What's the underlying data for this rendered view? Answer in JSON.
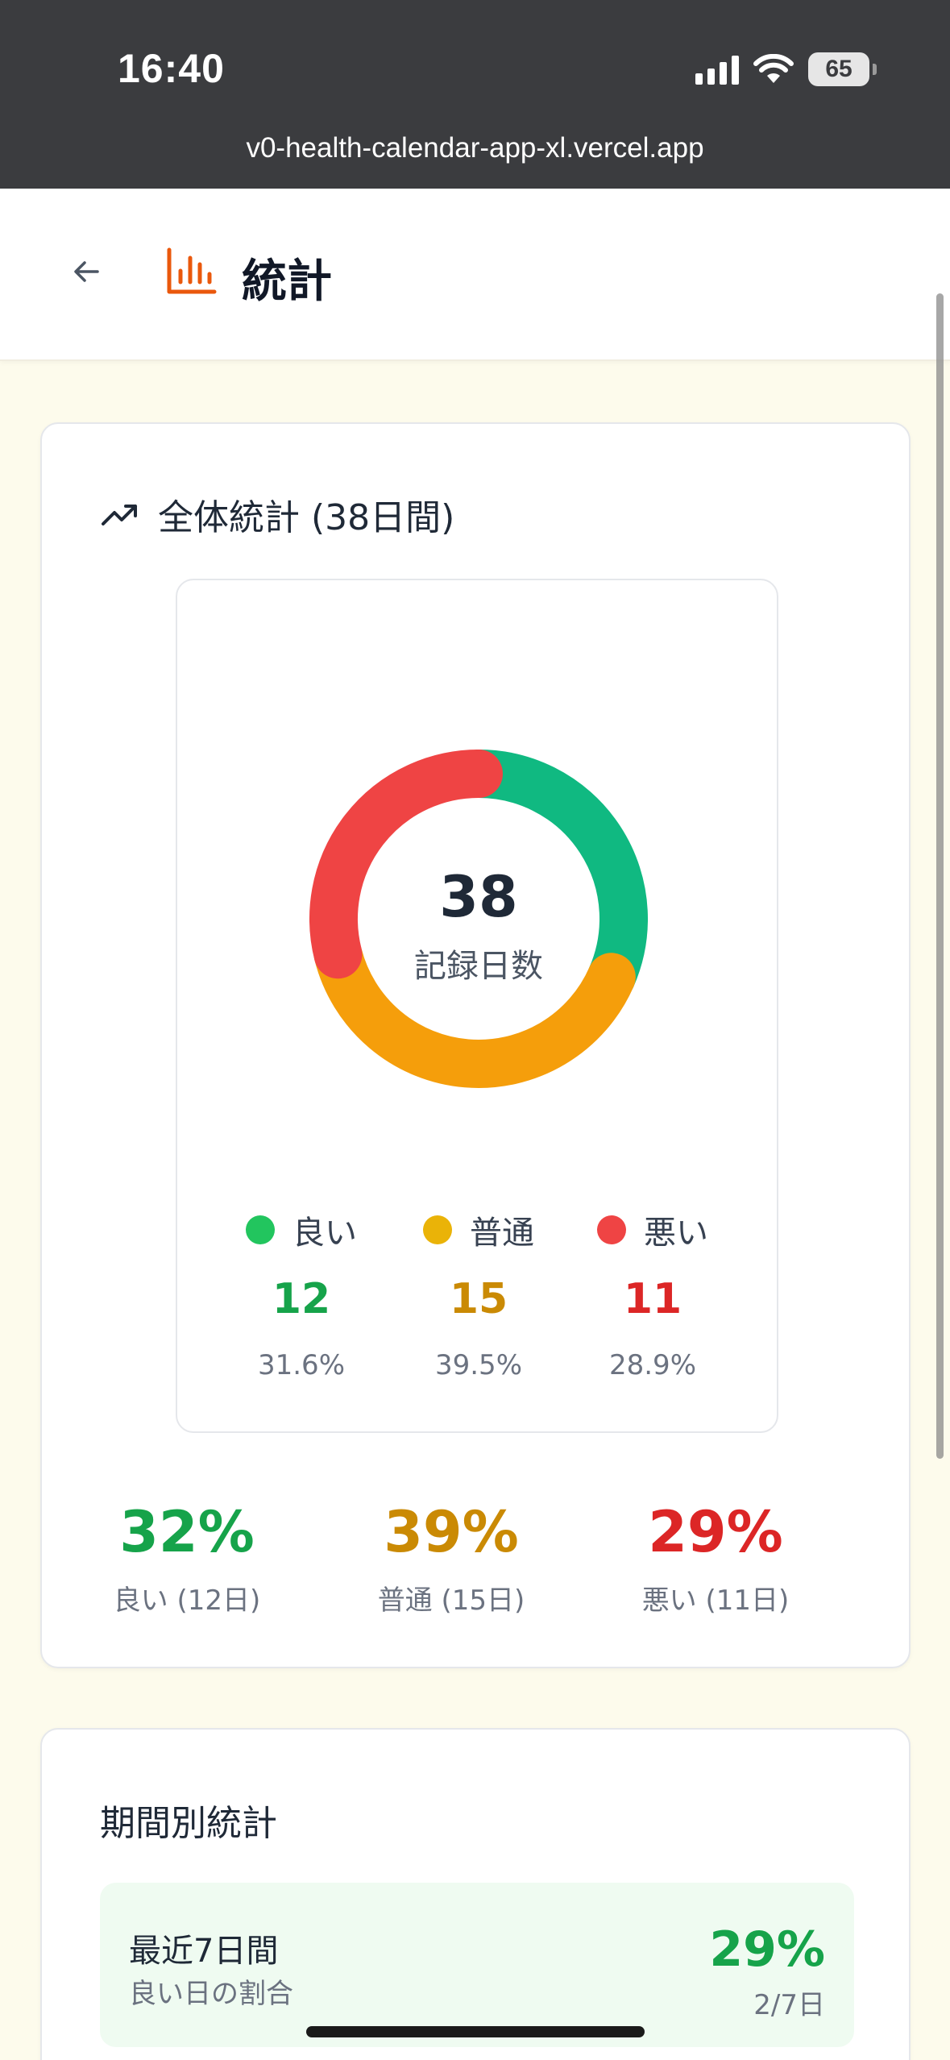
{
  "status_bar": {
    "time": "16:40",
    "battery": "65"
  },
  "browser": {
    "url": "v0-health-calendar-app-xl.vercel.app"
  },
  "header": {
    "title": "統計"
  },
  "overall": {
    "title": "全体統計 (38日間)",
    "total": "38",
    "total_label": "記録日数",
    "legend": [
      {
        "label": "良い",
        "count": "12",
        "percent": "31.6%",
        "color": "#22c55e",
        "text_color": "#16a34a"
      },
      {
        "label": "普通",
        "count": "15",
        "percent": "39.5%",
        "color": "#eab308",
        "text_color": "#ca8a04"
      },
      {
        "label": "悪い",
        "count": "11",
        "percent": "28.9%",
        "color": "#ef4444",
        "text_color": "#dc2626"
      }
    ],
    "summary": [
      {
        "percent": "32%",
        "label": "良い (12日)"
      },
      {
        "percent": "39%",
        "label": "普通 (15日)"
      },
      {
        "percent": "29%",
        "label": "悪い (11日)"
      }
    ]
  },
  "chart_data": {
    "type": "pie",
    "categories": [
      "良い",
      "普通",
      "悪い"
    ],
    "values": [
      12,
      15,
      11
    ],
    "colors": [
      "#10b981",
      "#f59e0b",
      "#ef4444"
    ]
  },
  "period": {
    "title": "期間別統計",
    "rows": [
      {
        "name": "最近7日間",
        "sub": "良い日の割合",
        "percent": "29%",
        "days": "2/7日"
      }
    ]
  }
}
